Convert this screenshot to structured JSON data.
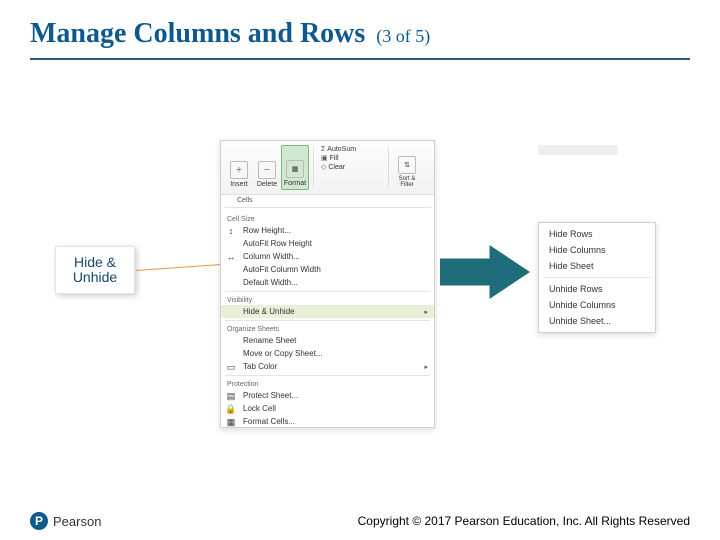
{
  "title_main": "Manage Columns and Rows",
  "title_counter": "(3 of 5)",
  "callout": {
    "line1": "Hide &",
    "line2": "Unhide"
  },
  "ribbon": {
    "buttons": {
      "insert": "Insert",
      "delete": "Delete",
      "format": "Format"
    },
    "quick": {
      "autosum": "AutoSum",
      "fill": "Fill",
      "clear": "Clear"
    },
    "sortfind": "Sort & Filter",
    "cells_label": "Cells"
  },
  "menu": {
    "sec_cellsize": "Cell Size",
    "row_height": "Row Height...",
    "autofit_row": "AutoFit Row Height",
    "col_width": "Column Width...",
    "autofit_col": "AutoFit Column Width",
    "default_width": "Default Width...",
    "sec_visibility": "Visibility",
    "hide_unhide": "Hide & Unhide",
    "sec_organize": "Organize Sheets",
    "rename": "Rename Sheet",
    "movecopy": "Move or Copy Sheet...",
    "tabcolor": "Tab Color",
    "sec_protect": "Protection",
    "protect": "Protect Sheet...",
    "lock": "Lock Cell",
    "formatcells": "Format Cells..."
  },
  "submenu": {
    "hide_rows": "Hide Rows",
    "hide_cols": "Hide Columns",
    "hide_sheet": "Hide Sheet",
    "unhide_rows": "Unhide Rows",
    "unhide_cols": "Unhide Columns",
    "unhide_sheet": "Unhide Sheet..."
  },
  "footer": {
    "brand": "Pearson",
    "copyright": "Copyright © 2017 Pearson Education, Inc. All Rights Reserved"
  }
}
